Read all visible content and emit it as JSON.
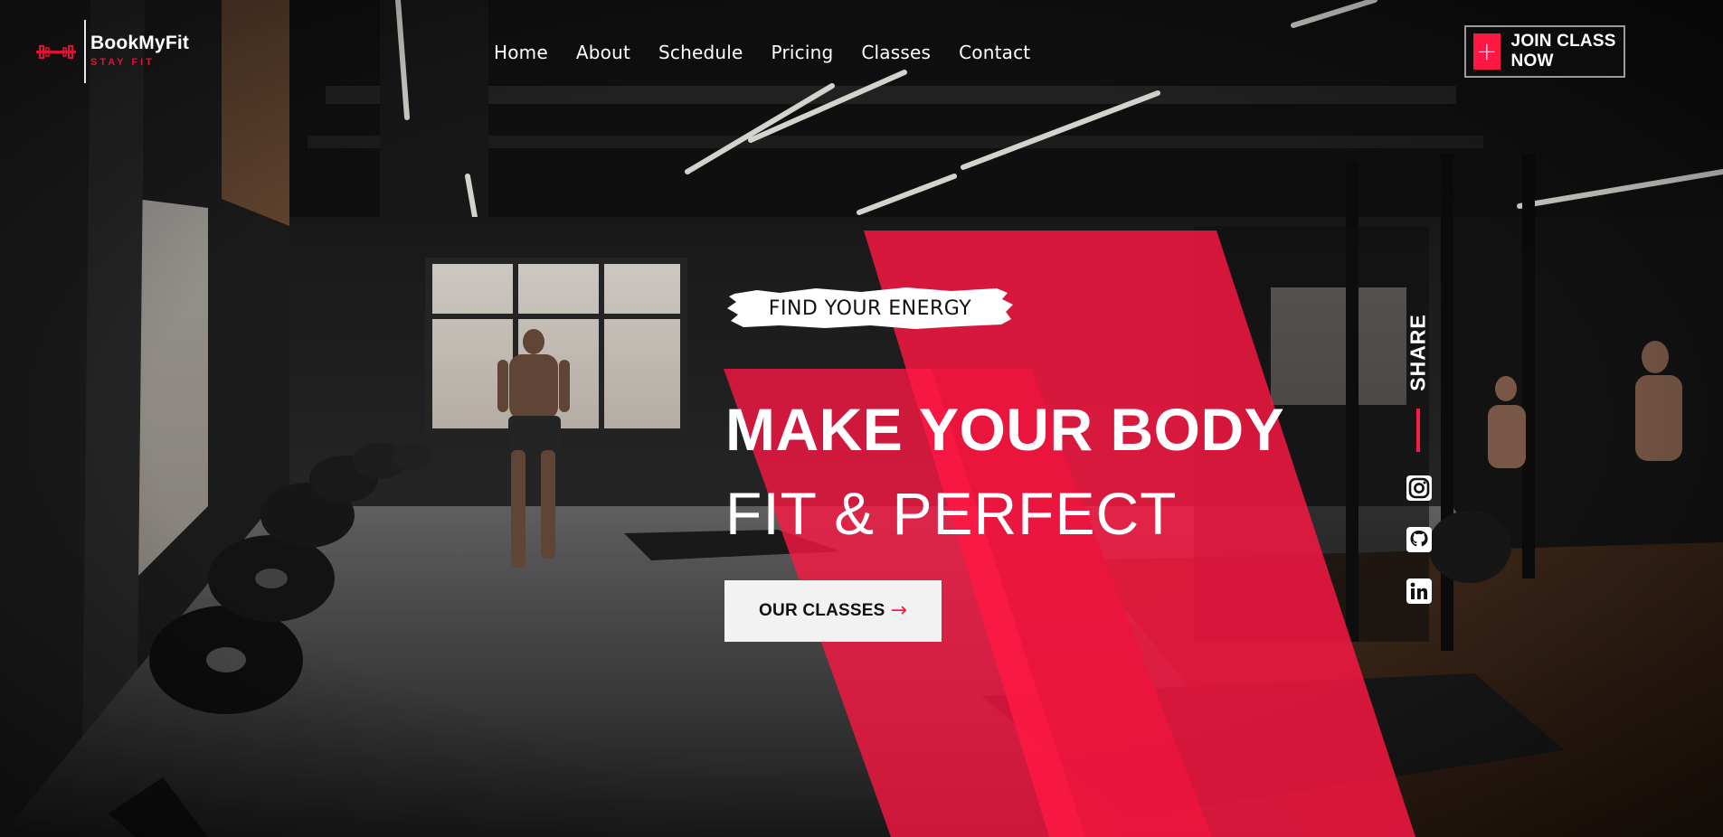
{
  "brand": {
    "name": "BookMyFit",
    "tagline": "STAY FIT",
    "accent_color": "#ff1744",
    "logo_icon": "dumbbell-icon"
  },
  "nav": {
    "items": [
      {
        "label": "Home"
      },
      {
        "label": "About"
      },
      {
        "label": "Schedule"
      },
      {
        "label": "Pricing"
      },
      {
        "label": "Classes"
      },
      {
        "label": "Contact"
      }
    ]
  },
  "cta": {
    "join_label": "JOIN CLASS NOW",
    "join_icon": "plus-icon"
  },
  "hero": {
    "eyebrow": "FIND YOUR ENERGY",
    "headline_line1": "MAKE YOUR BODY",
    "headline_line2": "FIT & PERFECT",
    "button_label": "OUR CLASSES",
    "button_icon": "arrow-right-icon"
  },
  "share": {
    "label": "SHARE",
    "icons": [
      "instagram-icon",
      "github-icon",
      "linkedin-icon"
    ]
  }
}
